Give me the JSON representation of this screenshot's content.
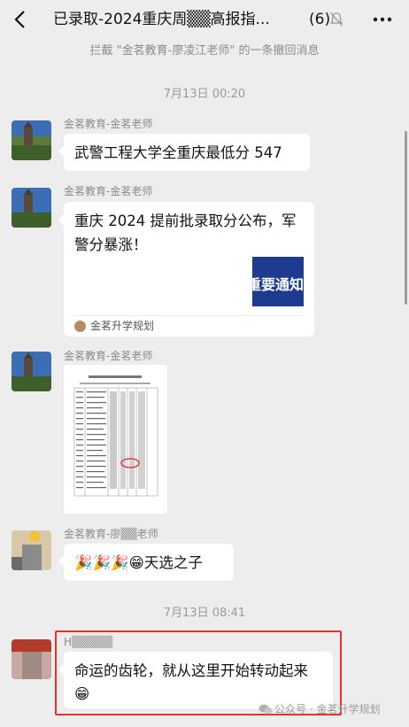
{
  "header": {
    "back_icon": "back-chevron-icon",
    "title": "已录取-2024重庆周▒▒高报指...",
    "member_count": "(6)",
    "mute_icon": "bell-muted-icon",
    "more_icon": "more-dots-icon"
  },
  "recall_note": "拦截 \"金茗教育-廖凌江老师\" 的一条撤回消息",
  "messages": [
    {
      "time": "7月13日 00:20"
    },
    {
      "sender": "金茗教育-金茗老师",
      "text": "武警工程大学全重庆最低分 547"
    },
    {
      "sender": "金茗教育-金茗老师",
      "card": {
        "title": "重庆 2024 提前批录取分公布，军警分暴涨！",
        "thumb_text": "重要通知",
        "source": "金茗升学规划"
      }
    },
    {
      "sender": "金茗教育-金茗老师",
      "image": "score-table-document"
    },
    {
      "sender": "金茗教育-廖▒▒老师",
      "text": "🎉🎉🎉😁天选之子"
    },
    {
      "time": "7月13日 08:41"
    },
    {
      "sender": "H▒▒▒▒▒",
      "text": "命运的齿轮，就从这里开始转动起来😁"
    }
  ],
  "watermark": "公众号 · 金茗升学规划",
  "colors": {
    "background": "#ededed",
    "bubble": "#ffffff",
    "highlight": "#e5322d",
    "card_thumb": "#1d3c8f"
  }
}
